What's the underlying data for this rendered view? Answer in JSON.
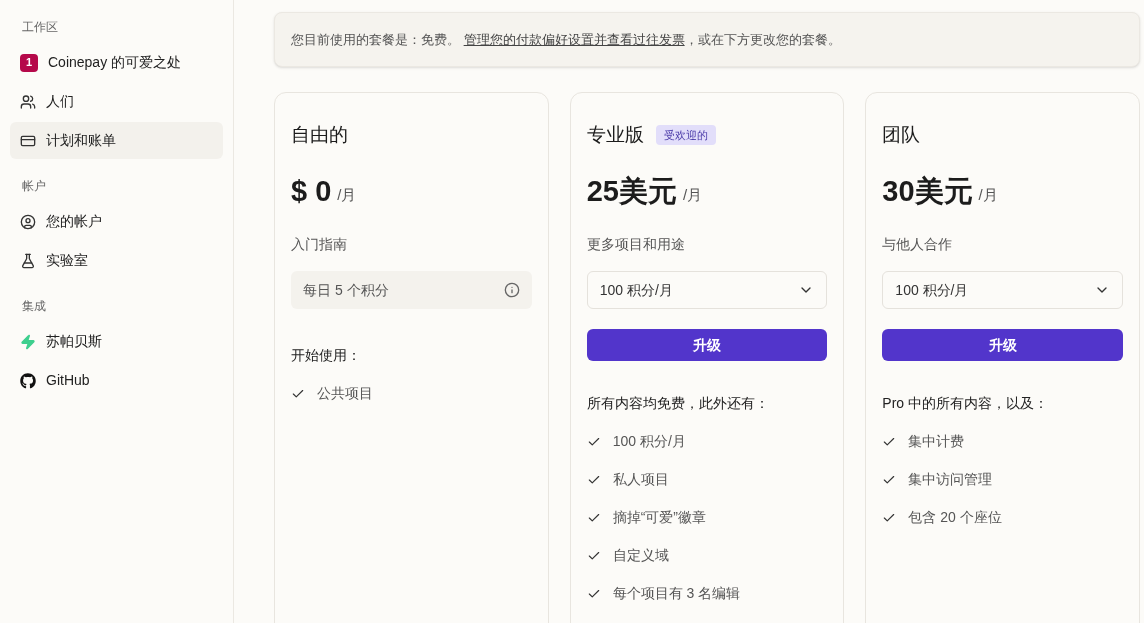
{
  "sidebar": {
    "sections": [
      {
        "heading": "工作区",
        "items": [
          {
            "kind": "workspace",
            "badge": "1",
            "label": "Coinepay 的可爱之处",
            "selected": false
          },
          {
            "kind": "people",
            "label": "人们",
            "selected": false
          },
          {
            "kind": "card",
            "label": "计划和账单",
            "selected": true
          }
        ]
      },
      {
        "heading": "帐户",
        "items": [
          {
            "kind": "user",
            "label": "您的帐户",
            "selected": false
          },
          {
            "kind": "lab",
            "label": "实验室",
            "selected": false
          }
        ]
      },
      {
        "heading": "集成",
        "items": [
          {
            "kind": "bolt",
            "label": "苏帕贝斯",
            "selected": false
          },
          {
            "kind": "github",
            "label": "GitHub",
            "selected": false
          }
        ]
      }
    ]
  },
  "banner": {
    "prefix": "您目前使用的套餐是：免费。",
    "link": "管理您的付款偏好设置并查看过往发票",
    "suffix": "，或在下方更改您的套餐。"
  },
  "plans": [
    {
      "kind": "free",
      "name": "自由的",
      "price": "$ 0",
      "period": "/月",
      "tagline": "入门指南",
      "credits": "每日 5 个积分",
      "features_heading": "开始使用：",
      "features": [
        "公共项目"
      ]
    },
    {
      "kind": "paid",
      "name": "专业版",
      "badge": "受欢迎的",
      "price": "25美元",
      "period": "/月",
      "tagline": "更多项目和用途",
      "credits": "100 积分/月",
      "button": "升级",
      "features_heading": "所有内容均免费，此外还有：",
      "features": [
        "100 积分/月",
        "私人项目",
        "摘掉“可爱”徽章",
        "自定义域",
        "每个项目有 3 名编辑"
      ]
    },
    {
      "kind": "paid",
      "name": "团队",
      "price": "30美元",
      "period": "/月",
      "tagline": "与他人合作",
      "credits": "100 积分/月",
      "button": "升级",
      "features_heading": "Pro 中的所有内容，以及：",
      "features": [
        "集中计费",
        "集中访问管理",
        "包含 20 个座位"
      ]
    }
  ]
}
